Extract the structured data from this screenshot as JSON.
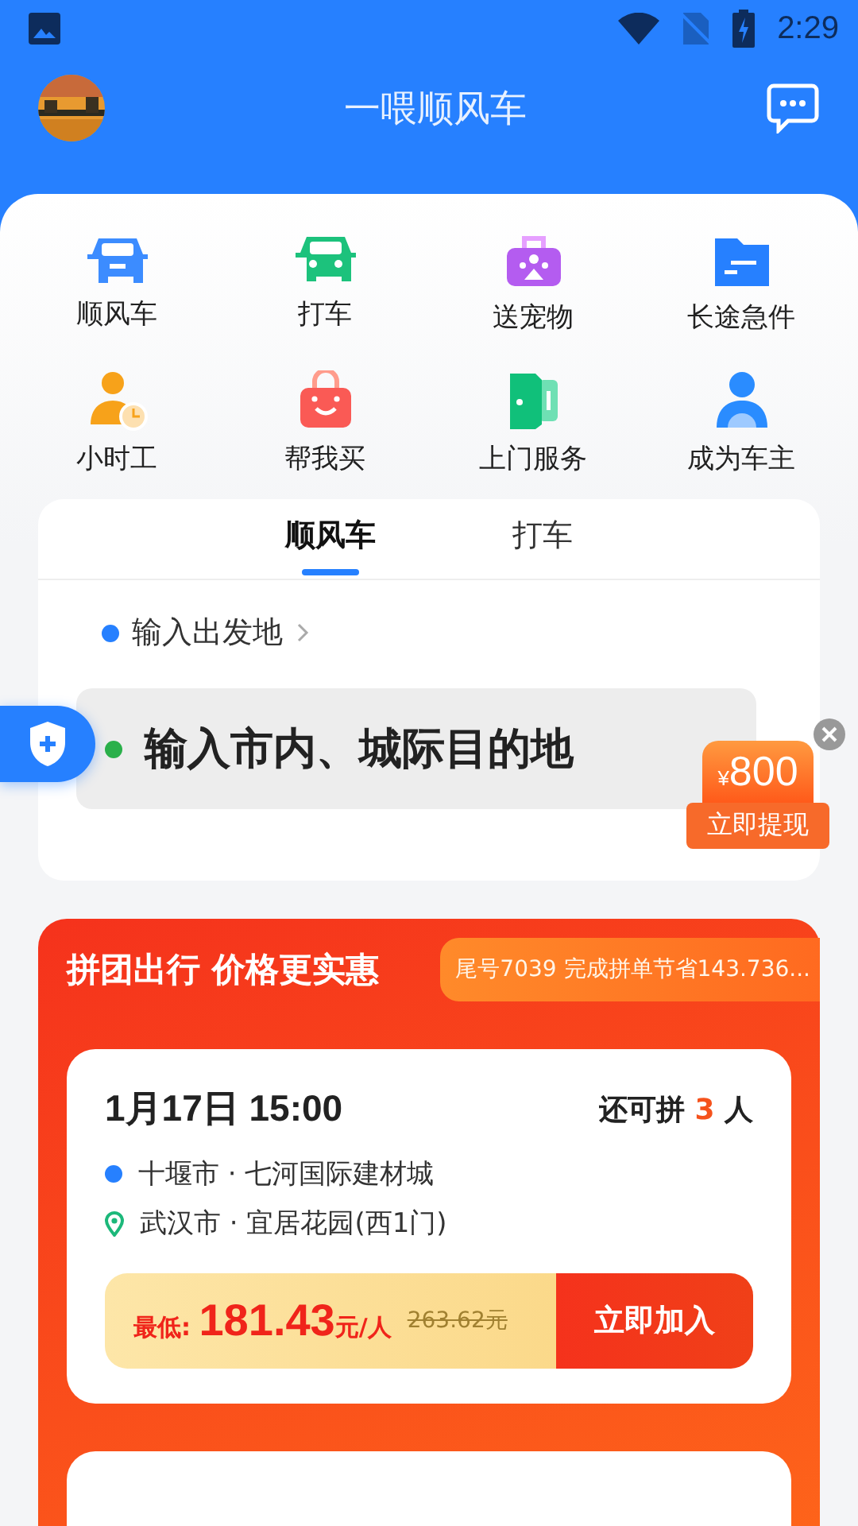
{
  "status_bar": {
    "time": "2:29"
  },
  "header": {
    "title": "一喂顺风车"
  },
  "services": [
    {
      "label": "顺风车",
      "kind": "car"
    },
    {
      "label": "打车",
      "kind": "taxi"
    },
    {
      "label": "送宠物",
      "kind": "pet"
    },
    {
      "label": "长途急件",
      "kind": "folder"
    },
    {
      "label": "小时工",
      "kind": "worker"
    },
    {
      "label": "帮我买",
      "kind": "bag"
    },
    {
      "label": "上门服务",
      "kind": "door"
    },
    {
      "label": "成为车主",
      "kind": "driver"
    }
  ],
  "booking": {
    "tabs": [
      {
        "label": "顺风车",
        "selected": true
      },
      {
        "label": "打车",
        "selected": false
      }
    ],
    "origin": {
      "placeholder": "输入出发地"
    },
    "destination": {
      "placeholder": "输入市内、城际目的地"
    }
  },
  "promo": {
    "currency": "¥",
    "amount": "800",
    "action": "立即提现"
  },
  "group": {
    "title": "拼团出行 价格更实惠",
    "ticker": "尾号7039 完成拼单节省143.736...",
    "trips": [
      {
        "date": "1月17日 15:00",
        "seats_label": "还可拼",
        "seats": "3",
        "seats_unit": "人",
        "from": "十堰市 · 七河国际建材城",
        "to": "武汉市 · 宜居花园(西1门)",
        "price_label": "最低:",
        "price": "181.43",
        "price_unit": "元/人",
        "original_price": "263.62元",
        "action": "立即加入"
      }
    ]
  }
}
